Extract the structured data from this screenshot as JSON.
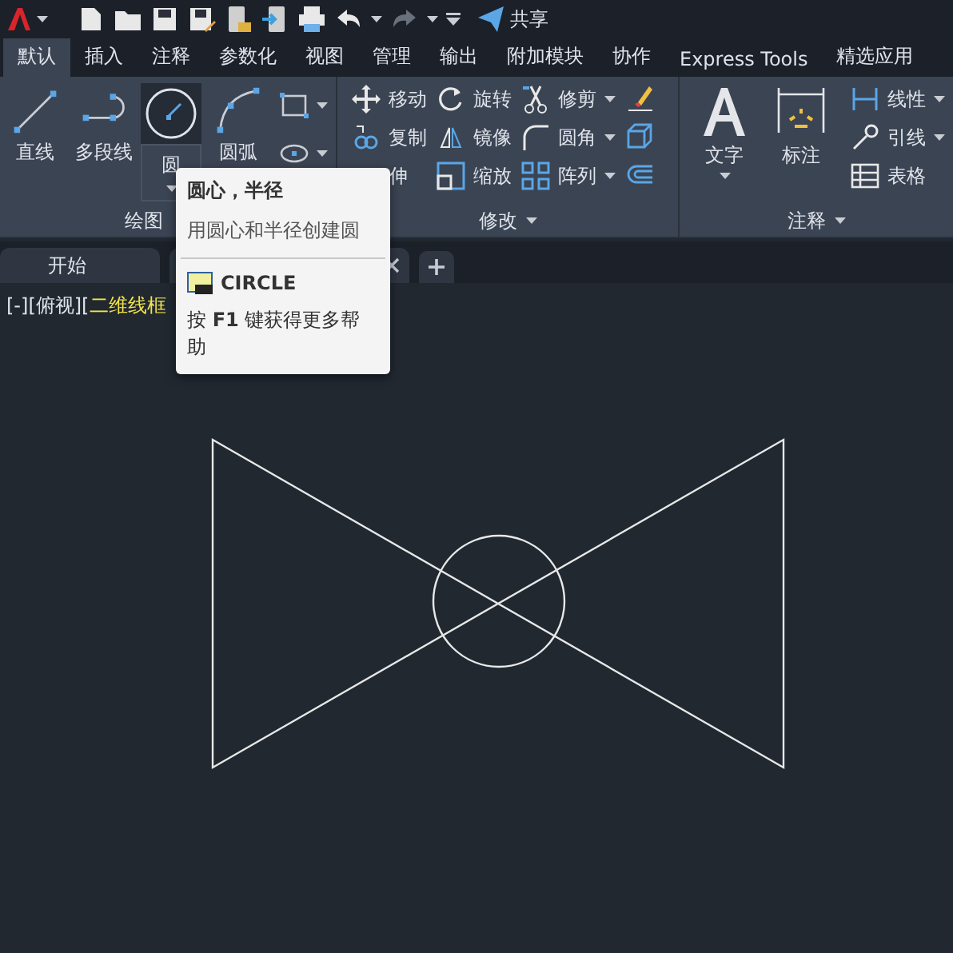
{
  "title_bar": {
    "share_label": "共享"
  },
  "ribbon_tabs": [
    {
      "label": "默认",
      "selected": true
    },
    {
      "label": "插入",
      "selected": false
    },
    {
      "label": "注释",
      "selected": false
    },
    {
      "label": "参数化",
      "selected": false
    },
    {
      "label": "视图",
      "selected": false
    },
    {
      "label": "管理",
      "selected": false
    },
    {
      "label": "输出",
      "selected": false
    },
    {
      "label": "附加模块",
      "selected": false
    },
    {
      "label": "协作",
      "selected": false
    },
    {
      "label": "Express Tools",
      "selected": false
    },
    {
      "label": "精选应用",
      "selected": false
    }
  ],
  "draw_panel": {
    "title": "绘图",
    "tools": [
      {
        "label": "直线",
        "selected": false
      },
      {
        "label": "多段线",
        "selected": false
      },
      {
        "label": "圆",
        "selected": true
      },
      {
        "label": "圆弧",
        "selected": false
      }
    ]
  },
  "modify_panel": {
    "title": "修改",
    "columns": [
      [
        {
          "label": "移动"
        },
        {
          "label": "复制"
        },
        {
          "label": "伸"
        }
      ],
      [
        {
          "label": "旋转"
        },
        {
          "label": "镜像"
        },
        {
          "label": "缩放"
        }
      ],
      [
        {
          "label": "修剪"
        },
        {
          "label": "圆角"
        },
        {
          "label": "阵列"
        }
      ]
    ]
  },
  "annotation_panel": {
    "title": "注释",
    "large_tools": [
      {
        "label": "文字"
      },
      {
        "label": "标注"
      }
    ],
    "tools": [
      {
        "label": "线性"
      },
      {
        "label": "引线"
      },
      {
        "label": "表格"
      }
    ]
  },
  "file_tabs": {
    "start_label": "开始"
  },
  "viewport": {
    "controls": "[-][俯视][",
    "visual_style": "二维线框"
  },
  "tooltip": {
    "title": "圆心，半径",
    "description": "用圆心和半径创建圆",
    "command": "CIRCLE",
    "help": "按 **F1** 键获得更多帮助"
  }
}
